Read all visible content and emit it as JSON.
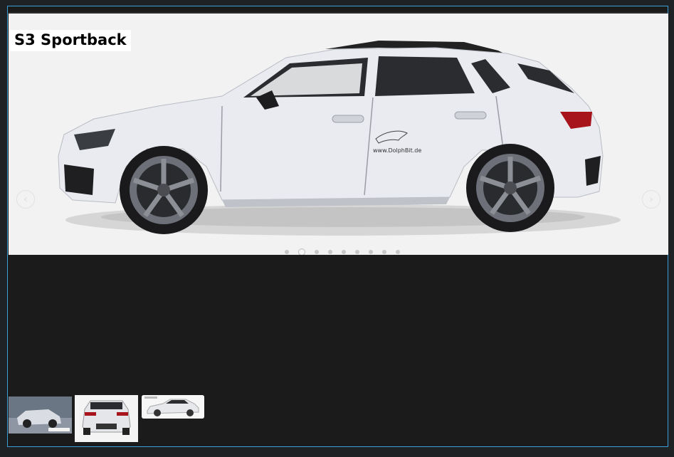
{
  "slide": {
    "title": "S3 Sportback",
    "watermark": "www.DolphBit.de",
    "prev_glyph": "‹",
    "next_glyph": "›",
    "dot_count": 9,
    "active_dot": 1
  },
  "colors": {
    "frame_border": "#3a9fd6",
    "page_bg": "#1b1b1b",
    "slide_bg": "#f2f2f2",
    "car_body": "#e8eaf0"
  },
  "thumbnails": [
    {
      "label": "thumbnail-1"
    },
    {
      "label": "thumbnail-2"
    },
    {
      "label": "thumbnail-3"
    }
  ]
}
